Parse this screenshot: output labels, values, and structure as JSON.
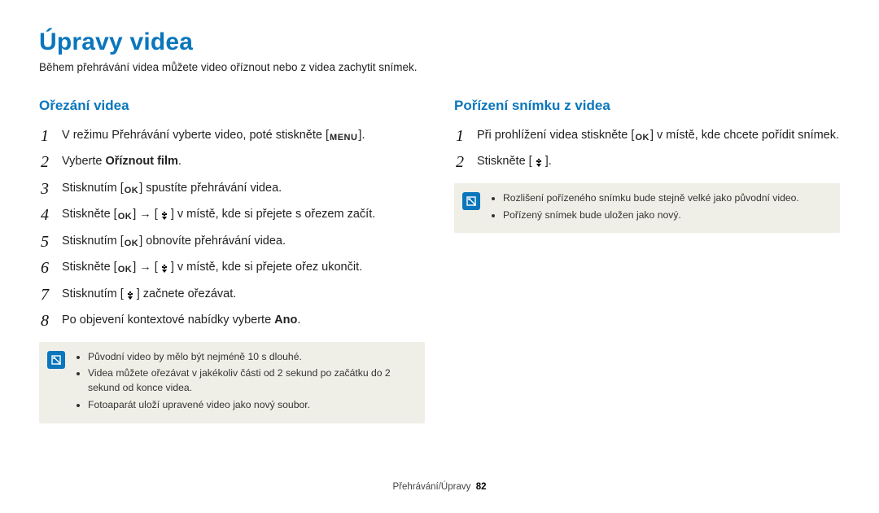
{
  "title": "Úpravy videa",
  "lead": "Během přehrávání videa můžete video oříznout nebo z videa zachytit snímek.",
  "icons": {
    "menu": "MENU",
    "ok": "OK"
  },
  "left": {
    "heading": "Ořezání videa",
    "step1_a": "V režimu Přehrávání vyberte video, poté stiskněte [",
    "step1_b": "].",
    "step2_a": "Vyberte ",
    "step2_bold": "Oříznout film",
    "step2_b": ".",
    "step3_a": "Stisknutím [",
    "step3_b": "] spustíte přehrávání videa.",
    "step4_a": "Stiskněte [",
    "step4_b": "] → [",
    "step4_c": "] v místě, kde si přejete s ořezem začít.",
    "step5_a": "Stisknutím [",
    "step5_b": "] obnovíte přehrávání videa.",
    "step6_a": "Stiskněte [",
    "step6_b": "] → [",
    "step6_c": "] v místě, kde si přejete ořez ukončit.",
    "step7_a": "Stisknutím [",
    "step7_b": "] začnete ořezávat.",
    "step8_a": "Po objevení kontextové nabídky vyberte ",
    "step8_bold": "Ano",
    "step8_b": ".",
    "note": [
      "Původní video by mělo být nejméně 10 s dlouhé.",
      "Videa můžete ořezávat v jakékoliv části od 2 sekund po začátku do 2 sekund od konce videa.",
      "Fotoaparát uloží upravené video jako nový soubor."
    ]
  },
  "right": {
    "heading": "Pořízení snímku z videa",
    "step1_a": "Při prohlížení videa stiskněte [",
    "step1_b": "] v místě, kde chcete pořídit snímek.",
    "step2_a": "Stiskněte [",
    "step2_b": "].",
    "note": [
      "Rozlišení pořízeného snímku bude stejně velké jako původní video.",
      "Pořízený snímek bude uložen jako nový."
    ]
  },
  "footer": {
    "path": "Přehrávání/Úpravy",
    "page": "82"
  }
}
